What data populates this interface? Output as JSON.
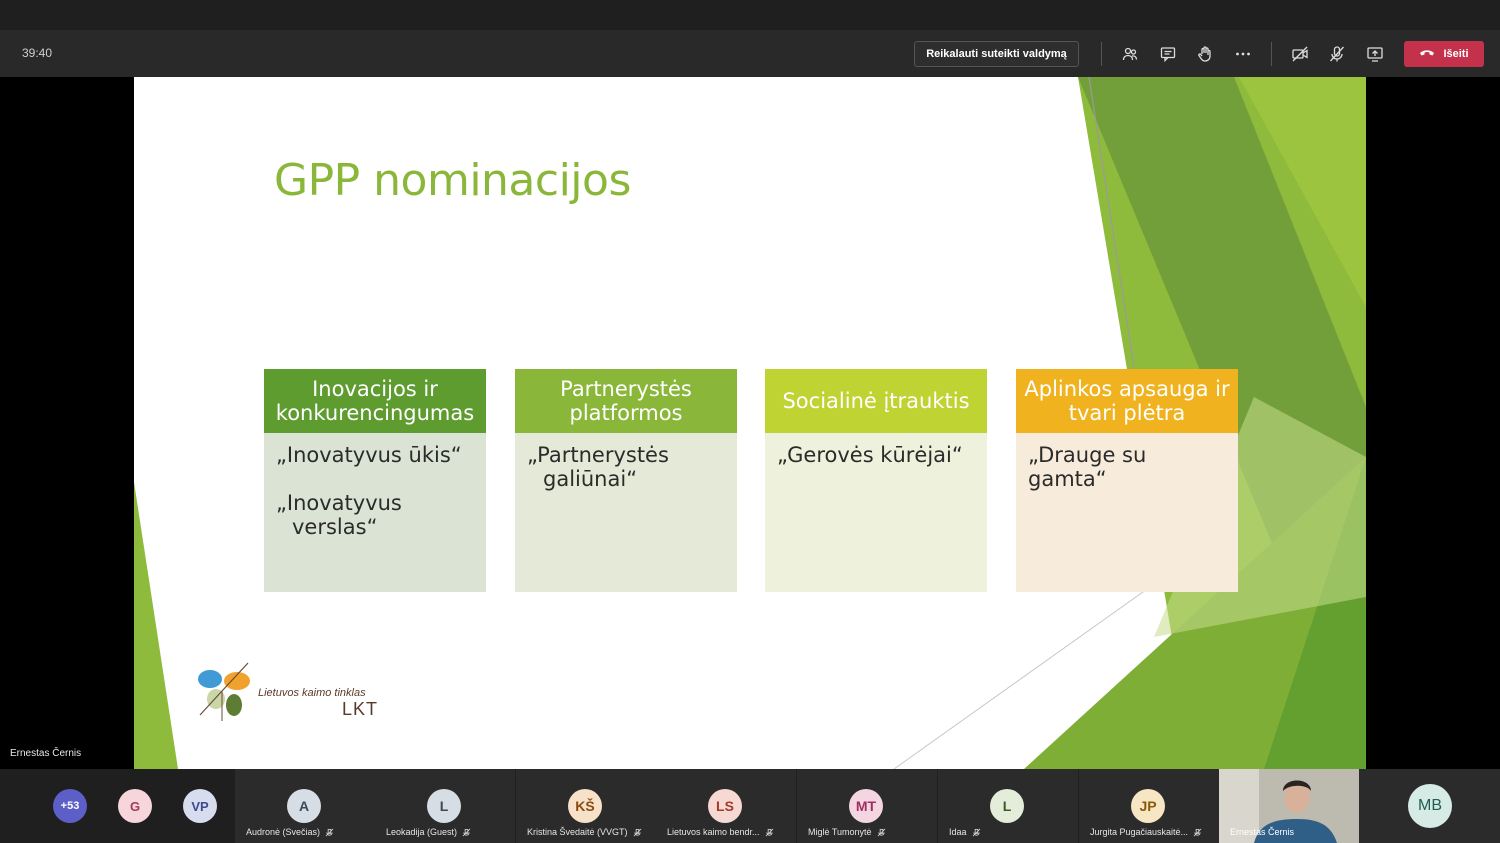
{
  "toolbar": {
    "timer": "39:40",
    "request_control_label": "Reikalauti suteikti valdymą",
    "leave_label": "Išeiti",
    "icons": [
      "participants-icon",
      "chat-icon",
      "raise-hand-icon",
      "more-options-icon",
      "camera-off-icon",
      "mic-off-icon",
      "share-screen-icon",
      "phone-hangup-icon"
    ]
  },
  "slide": {
    "title": "GPP nominacijos",
    "cards": [
      {
        "header": "Inovacijos ir konkurencingumas",
        "items": [
          "„Inovatyvus ūkis“",
          "„Inovatyvus",
          "verslas“"
        ],
        "header_color": "#5e9c2f",
        "body_color": "#dbe3d4"
      },
      {
        "header": "Partnerystės platformos",
        "items": [
          "„Partnerystės",
          "galiūnai“"
        ],
        "header_color": "#8ab73a",
        "body_color": "#e4ead7"
      },
      {
        "header": "Socialinė įtrauktis",
        "items": [
          "„Gerovės kūrėjai“"
        ],
        "header_color": "#bfd333",
        "body_color": "#eef1dc"
      },
      {
        "header": "Aplinkos apsauga ir tvari plėtra",
        "items": [
          "„Drauge su gamta“"
        ],
        "header_color": "#f0b31f",
        "body_color": "#f7ebdc"
      }
    ],
    "logo": {
      "line1": "Lietuvos kaimo tinklas",
      "line2": "LKT"
    }
  },
  "presenter_name": "Ernestas Černis",
  "participants": {
    "overflow": "+53",
    "small": [
      {
        "initials": "G",
        "bg": "#f6d5db",
        "fg": "#a33b52"
      },
      {
        "initials": "VP",
        "bg": "#d7dcef",
        "fg": "#3c4c8c"
      }
    ],
    "tiles": [
      {
        "initials": "A",
        "name": "Audronė (Svečias)",
        "bg": "#d6dde4",
        "fg": "#3a4a5a"
      },
      {
        "initials": "L",
        "name": "Leokadija (Guest)",
        "bg": "#d6dde4",
        "fg": "#3a4a5a"
      },
      {
        "initials": "KŠ",
        "name": "Kristina Švedaitė (VVGT)",
        "bg": "#f7e1c9",
        "fg": "#8a4b12"
      },
      {
        "initials": "LS",
        "name": "Lietuvos kaimo bendr...",
        "bg": "#f7d9d3",
        "fg": "#a33b2a"
      },
      {
        "initials": "MT",
        "name": "Miglė Tumonytė",
        "bg": "#f4d6e2",
        "fg": "#a02e60"
      },
      {
        "initials": "L",
        "name": "Idaa",
        "bg": "#e4edd9",
        "fg": "#3f5a26"
      },
      {
        "initials": "JP",
        "name": "Jurgita Pugačiauskaitė...",
        "bg": "#f7e6c4",
        "fg": "#8a5a0a"
      }
    ],
    "video_name": "Ernestas Černis",
    "last": {
      "initials": "MB",
      "bg": "#d6ebe6",
      "fg": "#1f5e52"
    }
  }
}
